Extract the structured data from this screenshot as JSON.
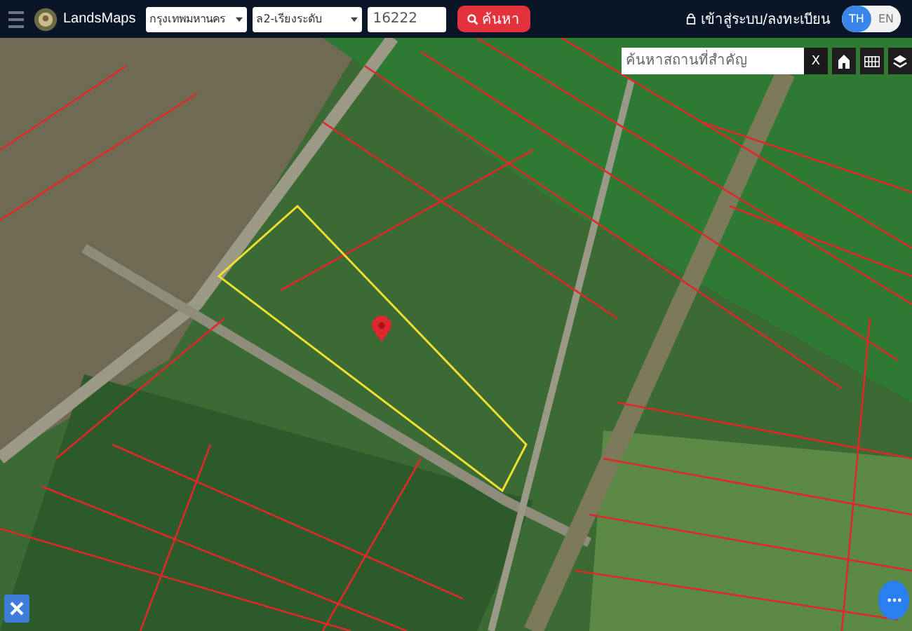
{
  "header": {
    "logo_text": "LandsMaps",
    "province": "กรุงเทพมหานคร",
    "district": "ล2-เรียงระดับ",
    "parcel_number": "16222",
    "search_button": "ค้นหา",
    "login": "เข้าสู่ระบบ/ลงทะเบียน",
    "languages": [
      {
        "label": "TH",
        "selected": true
      },
      {
        "label": "EN",
        "selected": false
      }
    ]
  },
  "map": {
    "place_search": {
      "placeholder": "ค้นหาสถานที่สำคัญ"
    },
    "clear_button": "X"
  }
}
